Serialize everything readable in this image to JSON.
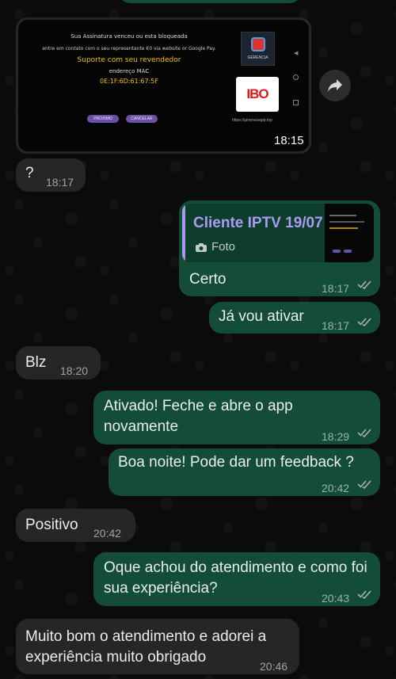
{
  "screenshot": {
    "line1": "Sua Assinatura venceu ou esta bloqueada",
    "line2": "entre em contato com o seu representante €0 via website or Google Pay.",
    "support": "Suporte com seu revendedor",
    "mac_label": "endereço MAC",
    "mac_value": "0E:1F:6D:61:67:5F",
    "btn_next": "PROXIMO",
    "btn_cancel": "CANCELAR",
    "logo1": "GERENCIA",
    "logo2": "IBO",
    "site": "https://gerenciaapp.top",
    "time": "18:15"
  },
  "messages": [
    {
      "dir": "in",
      "text": "?",
      "time": "18:17"
    },
    {
      "dir": "out",
      "reply_title": "Cliente IPTV 19/07",
      "reply_sub": "Foto",
      "text": "Certo",
      "time": "18:17"
    },
    {
      "dir": "out",
      "text": "Já vou ativar",
      "time": "18:17"
    },
    {
      "dir": "in",
      "text": "Blz",
      "time": "18:20"
    },
    {
      "dir": "out",
      "text": "Ativado! Feche e abre o app novamente",
      "time": "18:29"
    },
    {
      "dir": "out",
      "text": "Boa noite! Pode dar um feedback ?",
      "time": "20:42"
    },
    {
      "dir": "in",
      "text": "Positivo",
      "time": "20:42"
    },
    {
      "dir": "out",
      "text": "Oque achou do atendimento e como foi sua experiência?",
      "time": "20:43"
    },
    {
      "dir": "in",
      "text": "Muito bom o atendimento e adorei a experiência muito obrigado",
      "time": "20:46"
    }
  ],
  "colors": {
    "incoming": "#262628",
    "outgoing": "#144d37",
    "reply_accent": "#a79af2"
  },
  "icons": {
    "forward": "share-forward-icon",
    "camera": "camera-icon",
    "read": "double-check-icon"
  }
}
